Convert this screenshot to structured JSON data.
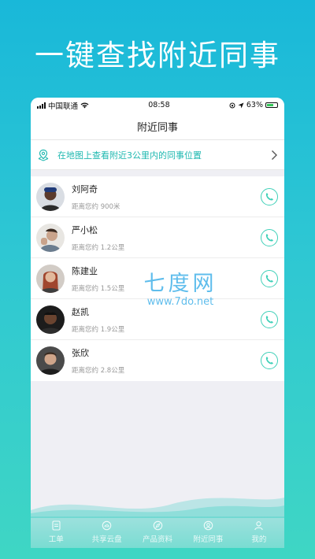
{
  "headline": "一键查找附近同事",
  "statusbar": {
    "carrier": "中国联通",
    "time": "08:58",
    "battery": "63%"
  },
  "page_title": "附近同事",
  "map_banner": {
    "text": "在地图上查看附近3公里内的同事位置",
    "icon": "location-pin-icon"
  },
  "colleagues": [
    {
      "name": "刘阿奇",
      "distance": "距离您约 900米"
    },
    {
      "name": "严小松",
      "distance": "距离您约 1.2公里"
    },
    {
      "name": "陈建业",
      "distance": "距离您约 1.5公里"
    },
    {
      "name": "赵凯",
      "distance": "距离您约 1.9公里"
    },
    {
      "name": "张欣",
      "distance": "距离您约 2.8公里"
    }
  ],
  "watermark": {
    "line1": "七度网",
    "line2": "www.7do.net"
  },
  "tabs": [
    {
      "label": "工单",
      "icon": "document-icon"
    },
    {
      "label": "共享云盘",
      "icon": "cloud-disk-icon"
    },
    {
      "label": "产品资料",
      "icon": "compass-icon"
    },
    {
      "label": "附近同事",
      "icon": "nearby-icon"
    },
    {
      "label": "我的",
      "icon": "person-icon"
    }
  ],
  "colors": {
    "accent": "#3fd0b8",
    "banner_text": "#1eb8b0",
    "bg_top": "#19b8d9",
    "bg_bottom": "#3fd6c4"
  }
}
